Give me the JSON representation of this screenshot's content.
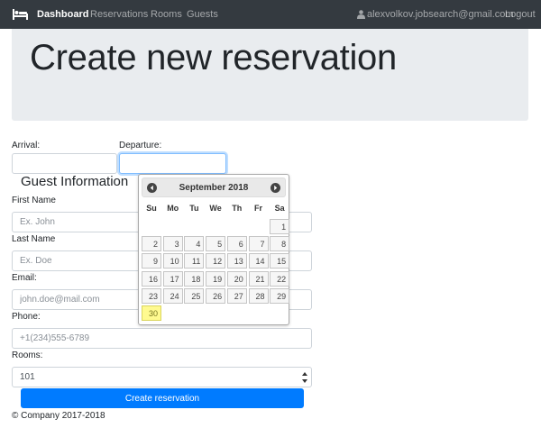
{
  "nav": {
    "brand_icon": "bed-icon",
    "links": [
      "Dashboard",
      "Reservations",
      "Rooms",
      "Guests"
    ],
    "user_email": "alexvolkov.jobsearch@gmail.com",
    "logout": "Logout"
  },
  "page": {
    "title": "Create new reservation"
  },
  "form": {
    "arrival_label": "Arrival:",
    "departure_label": "Departure:",
    "guest_section": "Guest Information",
    "first_name_label": "First Name",
    "first_name_placeholder": "Ex. John",
    "last_name_label": "Last Name",
    "last_name_placeholder": "Ex. Doe",
    "email_label": "Email:",
    "email_placeholder": "john.doe@mail.com",
    "phone_label": "Phone:",
    "phone_placeholder": "+1(234)555-6789",
    "rooms_label": "Rooms:",
    "rooms_value": "101",
    "submit": "Create reservation"
  },
  "datepicker": {
    "month_title": "September 2018",
    "weekdays": [
      "Su",
      "Mo",
      "Tu",
      "We",
      "Th",
      "Fr",
      "Sa"
    ],
    "first_weekday_index": 6,
    "days_in_month": 30,
    "today": 30,
    "prev_icon": "circle-arrow-left-icon",
    "next_icon": "circle-arrow-right-icon"
  },
  "footer": {
    "text": "© Company 2017-2018"
  },
  "colors": {
    "navbar": "#343a40",
    "jumbotron": "#e9ecef",
    "primary": "#007bff",
    "today": "#fffa90"
  }
}
